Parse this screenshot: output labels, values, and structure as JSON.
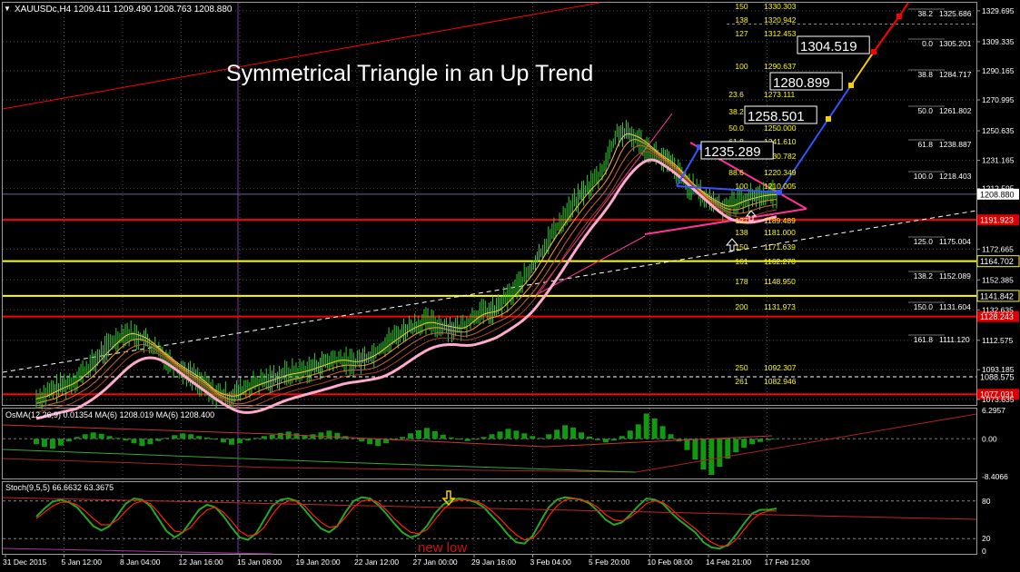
{
  "window": {
    "symbol_line": "XAUUSDc,H4  1209.411 1209.490 1208.763 1208.880",
    "title": "Symmetrical Triangle in an Up Trend"
  },
  "colors": {
    "background": "#000000",
    "grid": "#4a4a4a",
    "price_candles": "#33cc33",
    "resistance": "#ff0000",
    "fib_yellow": "#ffff00",
    "triangle": "#ff3399",
    "ma_fast": "#ff9900",
    "ma_slow": "#ff99cc",
    "osma_bars": "#119911",
    "stoch_main": "#22aa22",
    "stoch_signal": "#ff2200",
    "label_fill": "#dd0000"
  },
  "chart_data": [
    {
      "type": "line",
      "panel": "price",
      "title": "Symmetrical Triangle in an Up Trend",
      "x_ticks": [
        "31 Dec 2015",
        "5 Jan 12:00",
        "8 Jan 04:00",
        "12 Jan 16:00",
        "15 Jan 08:00",
        "19 Jan 20:00",
        "22 Jan 12:00",
        "27 Jan 00:00",
        "29 Jan 16:00",
        "3 Feb 04:00",
        "5 Feb 20:00",
        "10 Feb 08:00",
        "14 Feb 21:00",
        "17 Feb 12:00"
      ],
      "y_ticks": [
        1329.695,
        1309.335,
        1290.165,
        1270.995,
        1250.635,
        1231.165,
        1212.595,
        1172.665,
        1152.385,
        1132.635,
        1112.575,
        1093.185,
        1073.635
      ],
      "ylim": [
        1070,
        1335
      ],
      "current_price": "1208.880",
      "price_series": [
        1074,
        1080,
        1085,
        1095,
        1108,
        1118,
        1114,
        1104,
        1095,
        1088,
        1078,
        1075,
        1082,
        1086,
        1090,
        1092,
        1096,
        1100,
        1098,
        1103,
        1112,
        1120,
        1125,
        1122,
        1120,
        1130,
        1132,
        1144,
        1158,
        1178,
        1195,
        1210,
        1222,
        1250,
        1246,
        1236,
        1228,
        1215,
        1206,
        1200,
        1205,
        1208,
        1208.88
      ],
      "horizontal_lines": [
        {
          "label": "1191.923",
          "value": 1191.923,
          "color": "red"
        },
        {
          "label": "1164.702",
          "value": 1164.702,
          "color": "yellow"
        },
        {
          "label": "1141.842",
          "value": 1141.842,
          "color": "yellow"
        },
        {
          "label": "1128.243",
          "value": 1128.243,
          "color": "red"
        },
        {
          "label": "1077.031",
          "value": 1077.031,
          "color": "red"
        },
        {
          "label": "1088.575",
          "value": 1088.575,
          "color": "white-dashed"
        }
      ],
      "fib_levels_inner": [
        {
          "pct": "150",
          "value": "1330.303"
        },
        {
          "pct": "138",
          "value": "1320.942"
        },
        {
          "pct": "127",
          "value": "1312.453"
        },
        {
          "pct": "100",
          "value": "1290.637"
        },
        {
          "pct": "23.6",
          "value": "1273.111"
        },
        {
          "pct": "38.2",
          "value": "1260.222"
        },
        {
          "pct": "50.0",
          "value": "1250.000"
        },
        {
          "pct": "61.8",
          "value": "1241.610"
        },
        {
          "pct": "76.4",
          "value": "1230.782"
        },
        {
          "pct": "88.6",
          "value": "1220.349"
        },
        {
          "pct": "100",
          "value": "1210.005"
        },
        {
          "pct": "127",
          "value": "1189.489"
        },
        {
          "pct": "138",
          "value": "1181.000"
        },
        {
          "pct": "150",
          "value": "1171.639"
        },
        {
          "pct": "161",
          "value": "1162.278"
        },
        {
          "pct": "178",
          "value": "1148.950"
        },
        {
          "pct": "200",
          "value": "1131.973"
        },
        {
          "pct": "250",
          "value": "1092.307"
        },
        {
          "pct": "261",
          "value": "1082.946"
        }
      ],
      "fib_levels_right": [
        {
          "pct": "38.2",
          "value": "1325.686"
        },
        {
          "pct": "0.0",
          "value": "1305.201"
        },
        {
          "pct": "38.8",
          "value": "1284.717"
        },
        {
          "pct": "50.0",
          "value": "1261.802"
        },
        {
          "pct": "61.8",
          "value": "1238.887"
        },
        {
          "pct": "100.0",
          "value": "1218.403"
        },
        {
          "pct": "125.0",
          "value": "1175.004"
        },
        {
          "pct": "138.2",
          "value": "1152.089"
        },
        {
          "pct": "150.0",
          "value": "1131.604"
        },
        {
          "pct": "161.8",
          "value": "1111.120"
        }
      ],
      "targets": [
        "1235.289",
        "1258.501",
        "1280.899",
        "1304.519"
      ]
    },
    {
      "type": "bar",
      "panel": "osma",
      "label": "OsMA(12,26,9) 0.01354  MA(6) 1208.019  MA(6) 1208.400",
      "y_ticks": [
        "6.2957",
        "0.00",
        "-8.4066"
      ],
      "ylim": [
        -8.4066,
        6.2957
      ],
      "values": [
        -1.2,
        -1.8,
        -2.2,
        -1.5,
        -0.6,
        0.4,
        1.0,
        1.4,
        1.1,
        0.6,
        0.2,
        -0.4,
        -1.0,
        -1.6,
        -1.2,
        -0.5,
        0.2,
        0.8,
        1.2,
        1.0,
        0.6,
        0.3,
        -0.2,
        -0.8,
        -1.3,
        -1.0,
        -0.4,
        0.2,
        0.6,
        0.9,
        1.3,
        1.6,
        1.2,
        0.8,
        1.0,
        1.4,
        1.8,
        1.3,
        0.6,
        0.1,
        -0.6,
        -1.2,
        -1.6,
        -1.0,
        -0.3,
        0.4,
        1.2,
        1.9,
        2.4,
        1.7,
        0.9,
        0.3,
        -0.2,
        -0.5,
        -0.2,
        0.4,
        1.0,
        1.6,
        2.2,
        1.8,
        1.2,
        0.6,
        0.2,
        1.0,
        2.0,
        3.0,
        2.5,
        1.4,
        0.5,
        -0.3,
        -0.8,
        -0.4,
        0.6,
        1.8,
        3.2,
        5.6,
        4.5,
        2.8,
        1.0,
        -0.6,
        -2.5,
        -4.6,
        -6.8,
        -8.0,
        -6.2,
        -4.4,
        -3.0,
        -2.0,
        -1.2,
        -0.7,
        -0.3,
        -0.1
      ]
    },
    {
      "type": "line",
      "panel": "stochastic",
      "label": "Stoch(9,5,5) 66.6632 63.3675",
      "y_ticks": [
        "80",
        "20",
        "0"
      ],
      "ylim": [
        0,
        100
      ],
      "annotation": "new low",
      "main": [
        55,
        68,
        79,
        82,
        78,
        70,
        55,
        40,
        33,
        40,
        58,
        76,
        84,
        82,
        72,
        52,
        32,
        22,
        30,
        48,
        66,
        74,
        70,
        56,
        38,
        22,
        18,
        28,
        50,
        72,
        82,
        84,
        80,
        66,
        50,
        36,
        30,
        40,
        62,
        80,
        86,
        84,
        74,
        60,
        44,
        30,
        22,
        26,
        40,
        60,
        74,
        82,
        84,
        82,
        78,
        70,
        56,
        42,
        26,
        14,
        12,
        24,
        48,
        70,
        82,
        86,
        84,
        82,
        76,
        64,
        50,
        42,
        46,
        58,
        72,
        84,
        82,
        76,
        62,
        50,
        40,
        30,
        14,
        6,
        4,
        10,
        26,
        44,
        60,
        66,
        66,
        68
      ],
      "signal": [
        52,
        62,
        72,
        78,
        78,
        74,
        64,
        52,
        42,
        42,
        50,
        64,
        76,
        80,
        76,
        62,
        46,
        32,
        30,
        38,
        54,
        66,
        70,
        62,
        48,
        32,
        24,
        26,
        38,
        58,
        74,
        80,
        80,
        72,
        58,
        46,
        38,
        40,
        54,
        70,
        80,
        82,
        78,
        66,
        52,
        40,
        30,
        28,
        34,
        50,
        66,
        78,
        82,
        82,
        80,
        74,
        64,
        52,
        38,
        26,
        18,
        20,
        34,
        56,
        72,
        82,
        84,
        82,
        78,
        70,
        58,
        50,
        48,
        54,
        64,
        76,
        80,
        78,
        68,
        56,
        46,
        36,
        24,
        14,
        8,
        8,
        18,
        34,
        50,
        60,
        64,
        64
      ]
    }
  ]
}
